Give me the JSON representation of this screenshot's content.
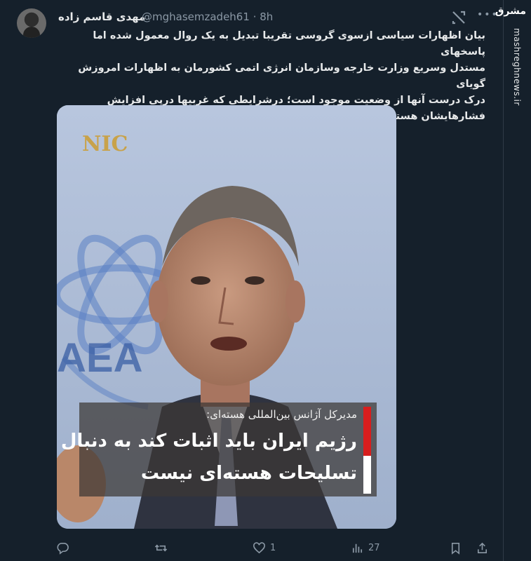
{
  "tweet": {
    "author_name": "مهدی قاسم زاده",
    "handle": "@mghasemzadeh61",
    "separator": "·",
    "time": "8h",
    "text_lines": [
      "بیان اظهارات سیاسی ازسوی گروسی تقریبا تبدیل به یک روال معمول شده اما پاسخهای",
      "مستدل وسریع وزارت خارجه وسازمان انرژی اتمی کشورمان به اظهارات امروزش گویای",
      "درک درست آنها از وضعیت موجود است؛ درشرایطی که غربیها درپی افزایش",
      "فشارهایشان هستند، اظهارات گروسی را باید درجهت کمک به آنها دید!"
    ]
  },
  "media": {
    "logo_text": "NIC",
    "caption_sub": "مدیرکل آژانس بین‌المللی هسته‌ای:",
    "caption_line1": "رژیم ایران باید اثبات کند به دنبال",
    "caption_line2": "تسلیحات هسته‌ای نیست",
    "backdrop_text": "AEA"
  },
  "actions": {
    "reply": {
      "icon": "reply-icon",
      "count": ""
    },
    "retweet": {
      "icon": "retweet-icon",
      "count": ""
    },
    "like": {
      "icon": "heart-icon",
      "count": "1"
    },
    "views": {
      "icon": "views-icon",
      "count": "27"
    },
    "bookmark": {
      "icon": "bookmark-icon",
      "count": ""
    },
    "share": {
      "icon": "share-icon",
      "count": ""
    }
  },
  "watermark": {
    "logo": "مشرق",
    "site": "mashreghnews.ir"
  },
  "colors": {
    "background": "#15202b",
    "text": "#e7e9ea",
    "muted": "#8b98a5",
    "caption_red": "#d81e1e",
    "logo_gold": "#c8a24a"
  }
}
